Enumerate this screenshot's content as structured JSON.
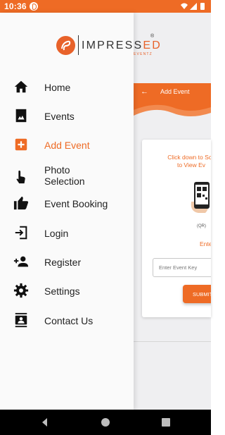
{
  "status_bar": {
    "time": "10:36"
  },
  "drawer": {
    "logo": {
      "brand_main": "IMPRESS",
      "brand_ed": "ED",
      "brand_reg": "®",
      "brand_sub": "EVENTZ"
    },
    "menu": [
      {
        "label": "Home",
        "icon": "home-icon",
        "active": false
      },
      {
        "label": "Events",
        "icon": "image-icon",
        "active": false
      },
      {
        "label": "Add Event",
        "icon": "add-box-icon",
        "active": true
      },
      {
        "label": "Photo\nSelection",
        "icon": "touch-icon",
        "active": false
      },
      {
        "label": "Event Booking",
        "icon": "thumb-up-icon",
        "active": false
      },
      {
        "label": "Login",
        "icon": "login-icon",
        "active": false
      },
      {
        "label": "Register",
        "icon": "person-add-icon",
        "active": false
      },
      {
        "label": "Settings",
        "icon": "gear-icon",
        "active": false
      },
      {
        "label": "Contact Us",
        "icon": "contacts-icon",
        "active": false
      }
    ]
  },
  "background_page": {
    "title": "Add Event",
    "instruction": "Click down to Sca\nto View Ev",
    "qr_caption": "(QR)",
    "enter_label": "Enter Even",
    "input_placeholder": "Enter Event Key",
    "submit_label": "SUBMIT"
  },
  "colors": {
    "accent": "#ee6b25",
    "drawer_bg": "#fafafa",
    "page_bg": "#efeff1"
  }
}
